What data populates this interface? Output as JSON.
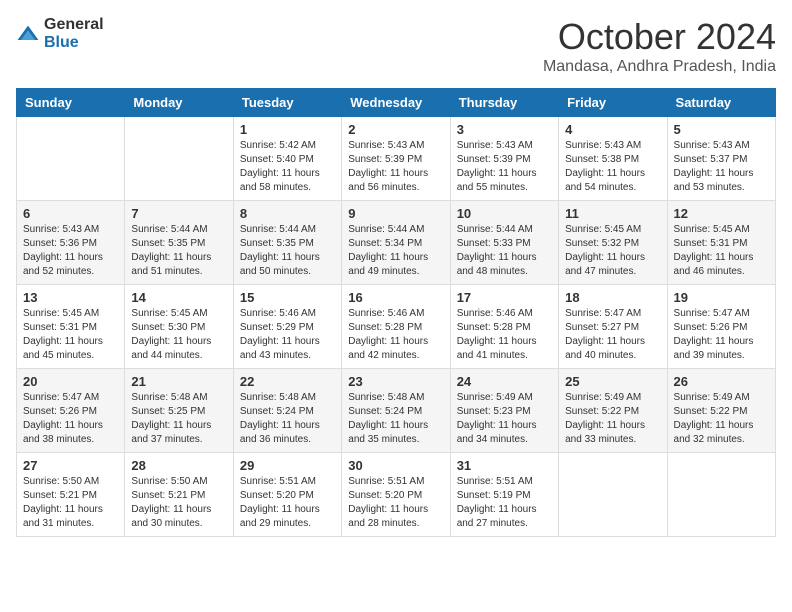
{
  "logo": {
    "general": "General",
    "blue": "Blue"
  },
  "title": "October 2024",
  "location": "Mandasa, Andhra Pradesh, India",
  "days_of_week": [
    "Sunday",
    "Monday",
    "Tuesday",
    "Wednesday",
    "Thursday",
    "Friday",
    "Saturday"
  ],
  "weeks": [
    [
      {
        "day": "",
        "info": ""
      },
      {
        "day": "",
        "info": ""
      },
      {
        "day": "1",
        "info": "Sunrise: 5:42 AM\nSunset: 5:40 PM\nDaylight: 11 hours and 58 minutes."
      },
      {
        "day": "2",
        "info": "Sunrise: 5:43 AM\nSunset: 5:39 PM\nDaylight: 11 hours and 56 minutes."
      },
      {
        "day": "3",
        "info": "Sunrise: 5:43 AM\nSunset: 5:39 PM\nDaylight: 11 hours and 55 minutes."
      },
      {
        "day": "4",
        "info": "Sunrise: 5:43 AM\nSunset: 5:38 PM\nDaylight: 11 hours and 54 minutes."
      },
      {
        "day": "5",
        "info": "Sunrise: 5:43 AM\nSunset: 5:37 PM\nDaylight: 11 hours and 53 minutes."
      }
    ],
    [
      {
        "day": "6",
        "info": "Sunrise: 5:43 AM\nSunset: 5:36 PM\nDaylight: 11 hours and 52 minutes."
      },
      {
        "day": "7",
        "info": "Sunrise: 5:44 AM\nSunset: 5:35 PM\nDaylight: 11 hours and 51 minutes."
      },
      {
        "day": "8",
        "info": "Sunrise: 5:44 AM\nSunset: 5:35 PM\nDaylight: 11 hours and 50 minutes."
      },
      {
        "day": "9",
        "info": "Sunrise: 5:44 AM\nSunset: 5:34 PM\nDaylight: 11 hours and 49 minutes."
      },
      {
        "day": "10",
        "info": "Sunrise: 5:44 AM\nSunset: 5:33 PM\nDaylight: 11 hours and 48 minutes."
      },
      {
        "day": "11",
        "info": "Sunrise: 5:45 AM\nSunset: 5:32 PM\nDaylight: 11 hours and 47 minutes."
      },
      {
        "day": "12",
        "info": "Sunrise: 5:45 AM\nSunset: 5:31 PM\nDaylight: 11 hours and 46 minutes."
      }
    ],
    [
      {
        "day": "13",
        "info": "Sunrise: 5:45 AM\nSunset: 5:31 PM\nDaylight: 11 hours and 45 minutes."
      },
      {
        "day": "14",
        "info": "Sunrise: 5:45 AM\nSunset: 5:30 PM\nDaylight: 11 hours and 44 minutes."
      },
      {
        "day": "15",
        "info": "Sunrise: 5:46 AM\nSunset: 5:29 PM\nDaylight: 11 hours and 43 minutes."
      },
      {
        "day": "16",
        "info": "Sunrise: 5:46 AM\nSunset: 5:28 PM\nDaylight: 11 hours and 42 minutes."
      },
      {
        "day": "17",
        "info": "Sunrise: 5:46 AM\nSunset: 5:28 PM\nDaylight: 11 hours and 41 minutes."
      },
      {
        "day": "18",
        "info": "Sunrise: 5:47 AM\nSunset: 5:27 PM\nDaylight: 11 hours and 40 minutes."
      },
      {
        "day": "19",
        "info": "Sunrise: 5:47 AM\nSunset: 5:26 PM\nDaylight: 11 hours and 39 minutes."
      }
    ],
    [
      {
        "day": "20",
        "info": "Sunrise: 5:47 AM\nSunset: 5:26 PM\nDaylight: 11 hours and 38 minutes."
      },
      {
        "day": "21",
        "info": "Sunrise: 5:48 AM\nSunset: 5:25 PM\nDaylight: 11 hours and 37 minutes."
      },
      {
        "day": "22",
        "info": "Sunrise: 5:48 AM\nSunset: 5:24 PM\nDaylight: 11 hours and 36 minutes."
      },
      {
        "day": "23",
        "info": "Sunrise: 5:48 AM\nSunset: 5:24 PM\nDaylight: 11 hours and 35 minutes."
      },
      {
        "day": "24",
        "info": "Sunrise: 5:49 AM\nSunset: 5:23 PM\nDaylight: 11 hours and 34 minutes."
      },
      {
        "day": "25",
        "info": "Sunrise: 5:49 AM\nSunset: 5:22 PM\nDaylight: 11 hours and 33 minutes."
      },
      {
        "day": "26",
        "info": "Sunrise: 5:49 AM\nSunset: 5:22 PM\nDaylight: 11 hours and 32 minutes."
      }
    ],
    [
      {
        "day": "27",
        "info": "Sunrise: 5:50 AM\nSunset: 5:21 PM\nDaylight: 11 hours and 31 minutes."
      },
      {
        "day": "28",
        "info": "Sunrise: 5:50 AM\nSunset: 5:21 PM\nDaylight: 11 hours and 30 minutes."
      },
      {
        "day": "29",
        "info": "Sunrise: 5:51 AM\nSunset: 5:20 PM\nDaylight: 11 hours and 29 minutes."
      },
      {
        "day": "30",
        "info": "Sunrise: 5:51 AM\nSunset: 5:20 PM\nDaylight: 11 hours and 28 minutes."
      },
      {
        "day": "31",
        "info": "Sunrise: 5:51 AM\nSunset: 5:19 PM\nDaylight: 11 hours and 27 minutes."
      },
      {
        "day": "",
        "info": ""
      },
      {
        "day": "",
        "info": ""
      }
    ]
  ]
}
